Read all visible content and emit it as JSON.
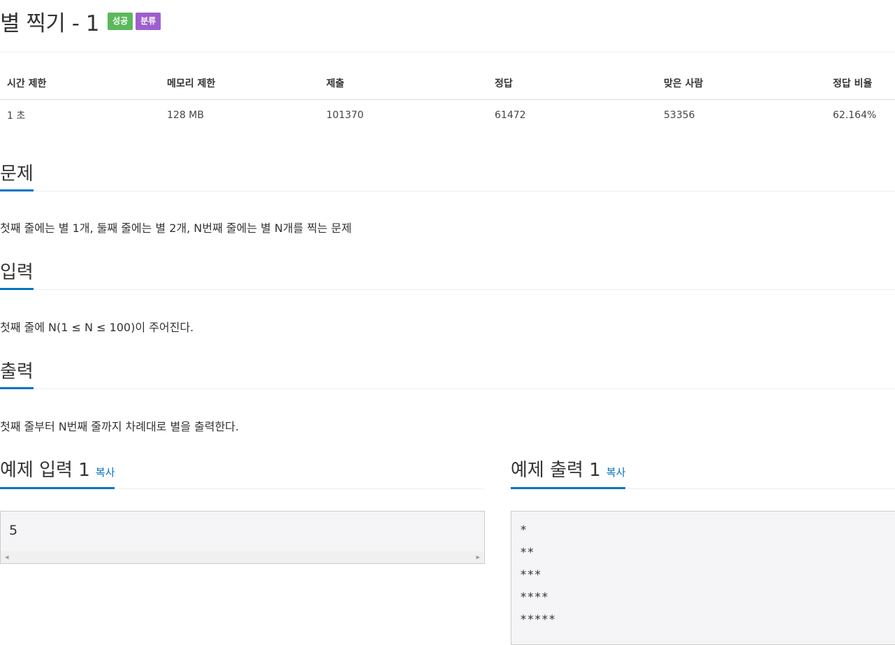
{
  "problem": {
    "title": "별 찍기 - 1",
    "badges": [
      {
        "label": "성공",
        "color": "#5cb85c"
      },
      {
        "label": "분류",
        "color": "#9e5fce"
      }
    ]
  },
  "info_table": {
    "headers": [
      "시간 제한",
      "메모리 제한",
      "제출",
      "정답",
      "맞은 사람",
      "정답 비율"
    ],
    "values": [
      "1 초",
      "128 MB",
      "101370",
      "61472",
      "53356",
      "62.164%"
    ]
  },
  "sections": {
    "problem": {
      "title": "문제",
      "text": "첫째 줄에는 별 1개, 둘째 줄에는 별 2개, N번째 줄에는 별 N개를 찍는 문제"
    },
    "input": {
      "title": "입력",
      "text": "첫째 줄에 N(1 ≤ N ≤ 100)이 주어진다."
    },
    "output": {
      "title": "출력",
      "text": "첫째 줄부터 N번째 줄까지 차례대로 별을 출력한다."
    }
  },
  "samples": {
    "input": {
      "title": "예제 입력 1",
      "copy_label": "복사",
      "lines": [
        "5"
      ]
    },
    "output": {
      "title": "예제 출력 1",
      "copy_label": "복사",
      "lines": [
        "*",
        "**",
        "***",
        "****",
        "*****"
      ]
    }
  },
  "colors": {
    "accent": "#0076c0",
    "link": "#0076c0",
    "success_badge": "#5cb85c",
    "category_badge": "#9e5fce"
  }
}
